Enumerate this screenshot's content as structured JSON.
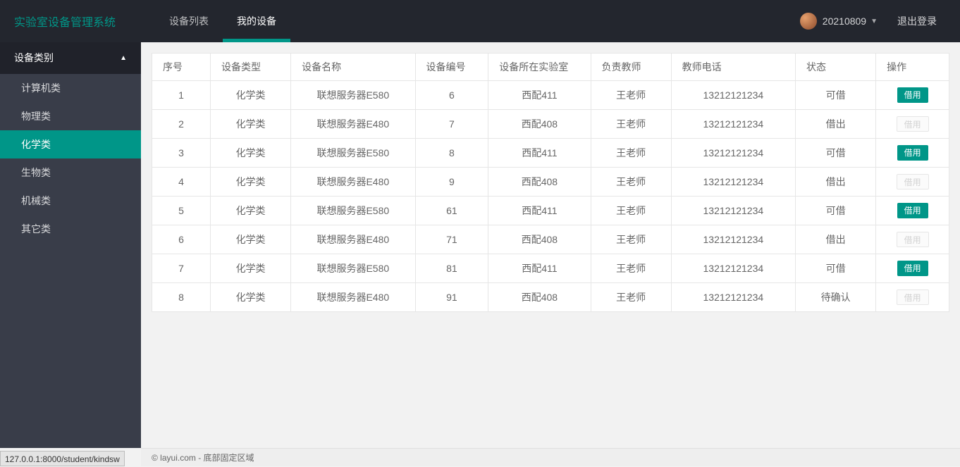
{
  "app": {
    "title": "实验室设备管理系统",
    "user": "20210809",
    "logout": "退出登录"
  },
  "nav": {
    "items": [
      {
        "label": "设备列表",
        "active": false
      },
      {
        "label": "我的设备",
        "active": true
      }
    ]
  },
  "sidebar": {
    "header": "设备类别",
    "items": [
      {
        "label": "计算机类",
        "active": false
      },
      {
        "label": "物理类",
        "active": false
      },
      {
        "label": "化学类",
        "active": true
      },
      {
        "label": "生物类",
        "active": false
      },
      {
        "label": "机械类",
        "active": false
      },
      {
        "label": "其它类",
        "active": false
      }
    ]
  },
  "table": {
    "headers": {
      "idx": "序号",
      "type": "设备类型",
      "name": "设备名称",
      "code": "设备编号",
      "lab": "设备所在实验室",
      "teacher": "负责教师",
      "phone": "教师电话",
      "status": "状态",
      "action": "操作"
    },
    "action_label": "借用",
    "rows": [
      {
        "idx": "1",
        "type": "化学类",
        "name": "联想服务器E580",
        "code": "6",
        "lab": "西配411",
        "teacher": "王老师",
        "phone": "13212121234",
        "status": "可借",
        "enabled": true
      },
      {
        "idx": "2",
        "type": "化学类",
        "name": "联想服务器E480",
        "code": "7",
        "lab": "西配408",
        "teacher": "王老师",
        "phone": "13212121234",
        "status": "借出",
        "enabled": false
      },
      {
        "idx": "3",
        "type": "化学类",
        "name": "联想服务器E580",
        "code": "8",
        "lab": "西配411",
        "teacher": "王老师",
        "phone": "13212121234",
        "status": "可借",
        "enabled": true
      },
      {
        "idx": "4",
        "type": "化学类",
        "name": "联想服务器E480",
        "code": "9",
        "lab": "西配408",
        "teacher": "王老师",
        "phone": "13212121234",
        "status": "借出",
        "enabled": false
      },
      {
        "idx": "5",
        "type": "化学类",
        "name": "联想服务器E580",
        "code": "61",
        "lab": "西配411",
        "teacher": "王老师",
        "phone": "13212121234",
        "status": "可借",
        "enabled": true
      },
      {
        "idx": "6",
        "type": "化学类",
        "name": "联想服务器E480",
        "code": "71",
        "lab": "西配408",
        "teacher": "王老师",
        "phone": "13212121234",
        "status": "借出",
        "enabled": false
      },
      {
        "idx": "7",
        "type": "化学类",
        "name": "联想服务器E580",
        "code": "81",
        "lab": "西配411",
        "teacher": "王老师",
        "phone": "13212121234",
        "status": "可借",
        "enabled": true
      },
      {
        "idx": "8",
        "type": "化学类",
        "name": "联想服务器E480",
        "code": "91",
        "lab": "西配408",
        "teacher": "王老师",
        "phone": "13212121234",
        "status": "待确认",
        "enabled": false
      }
    ]
  },
  "footer": "© layui.com - 底部固定区域",
  "statusbar": "127.0.0.1:8000/student/kindsw"
}
